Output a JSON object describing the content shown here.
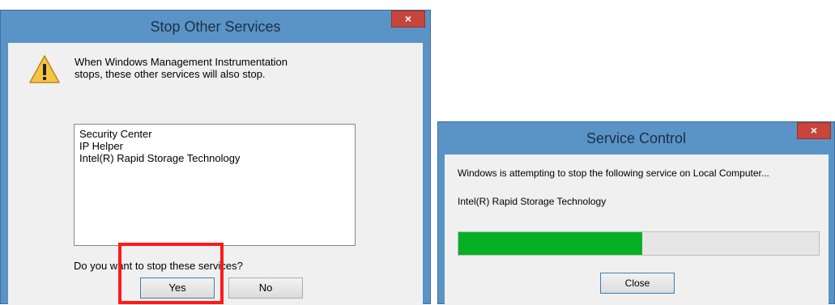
{
  "stop_dialog": {
    "title": "Stop Other Services",
    "close_glyph": "×",
    "message": "When Windows Management Instrumentation stops, these other services will also stop.",
    "services": [
      "Security Center",
      "IP Helper",
      "Intel(R) Rapid Storage Technology"
    ],
    "question": "Do you want to stop these services?",
    "yes_label": "Yes",
    "no_label": "No",
    "icon": "warning-icon"
  },
  "service_control": {
    "title": "Service Control",
    "close_glyph": "×",
    "message": "Windows is attempting to stop the following service on Local Computer...",
    "service_name": "Intel(R) Rapid Storage Technology",
    "progress_percent": 51,
    "close_label": "Close"
  },
  "colors": {
    "title_bar": "#5a94c6",
    "close_button": "#c7463c",
    "progress_fill": "#06b025",
    "highlight": "#ff1a1a"
  }
}
